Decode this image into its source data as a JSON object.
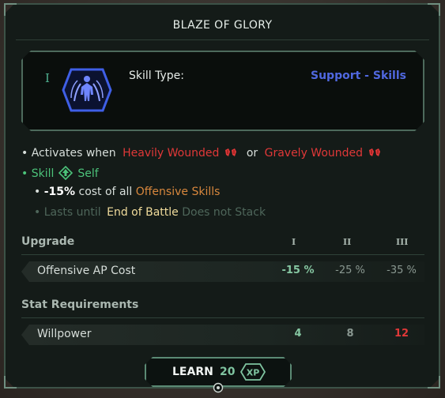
{
  "title": "BLAZE OF GLORY",
  "skill": {
    "tier": "I",
    "icon": "soldier-aura-icon",
    "type_label": "Skill Type:",
    "type_value": "Support - Skills"
  },
  "description": {
    "activates_prefix": "Activates when",
    "heavily_wounded": "Heavily Wounded",
    "or_text": "or",
    "gravely_wounded": "Gravely Wounded",
    "skill_label": "Skill",
    "self_label": "Self",
    "bonus_value": "-15%",
    "bonus_text": "cost of all",
    "bonus_target": "Offensive Skills",
    "lasts_prefix": "Lasts until",
    "lasts_value": "End of Battle",
    "stack_note": "Does not Stack"
  },
  "upgrade": {
    "header": "Upgrade",
    "levels": [
      "I",
      "II",
      "III"
    ],
    "row_label": "Offensive AP Cost",
    "values": [
      "-15 %",
      "-25 %",
      "-35 %"
    ]
  },
  "requirements": {
    "header": "Stat Requirements",
    "row_label": "Willpower",
    "values": [
      "4",
      "8",
      "12"
    ]
  },
  "learn": {
    "label": "LEARN",
    "cost": "20",
    "currency": "XP"
  },
  "colors": {
    "accent_green": "#4cc37a",
    "wound_red": "#e03838",
    "skill_blue": "#5068e0",
    "offensive_orange": "#d8873d"
  }
}
